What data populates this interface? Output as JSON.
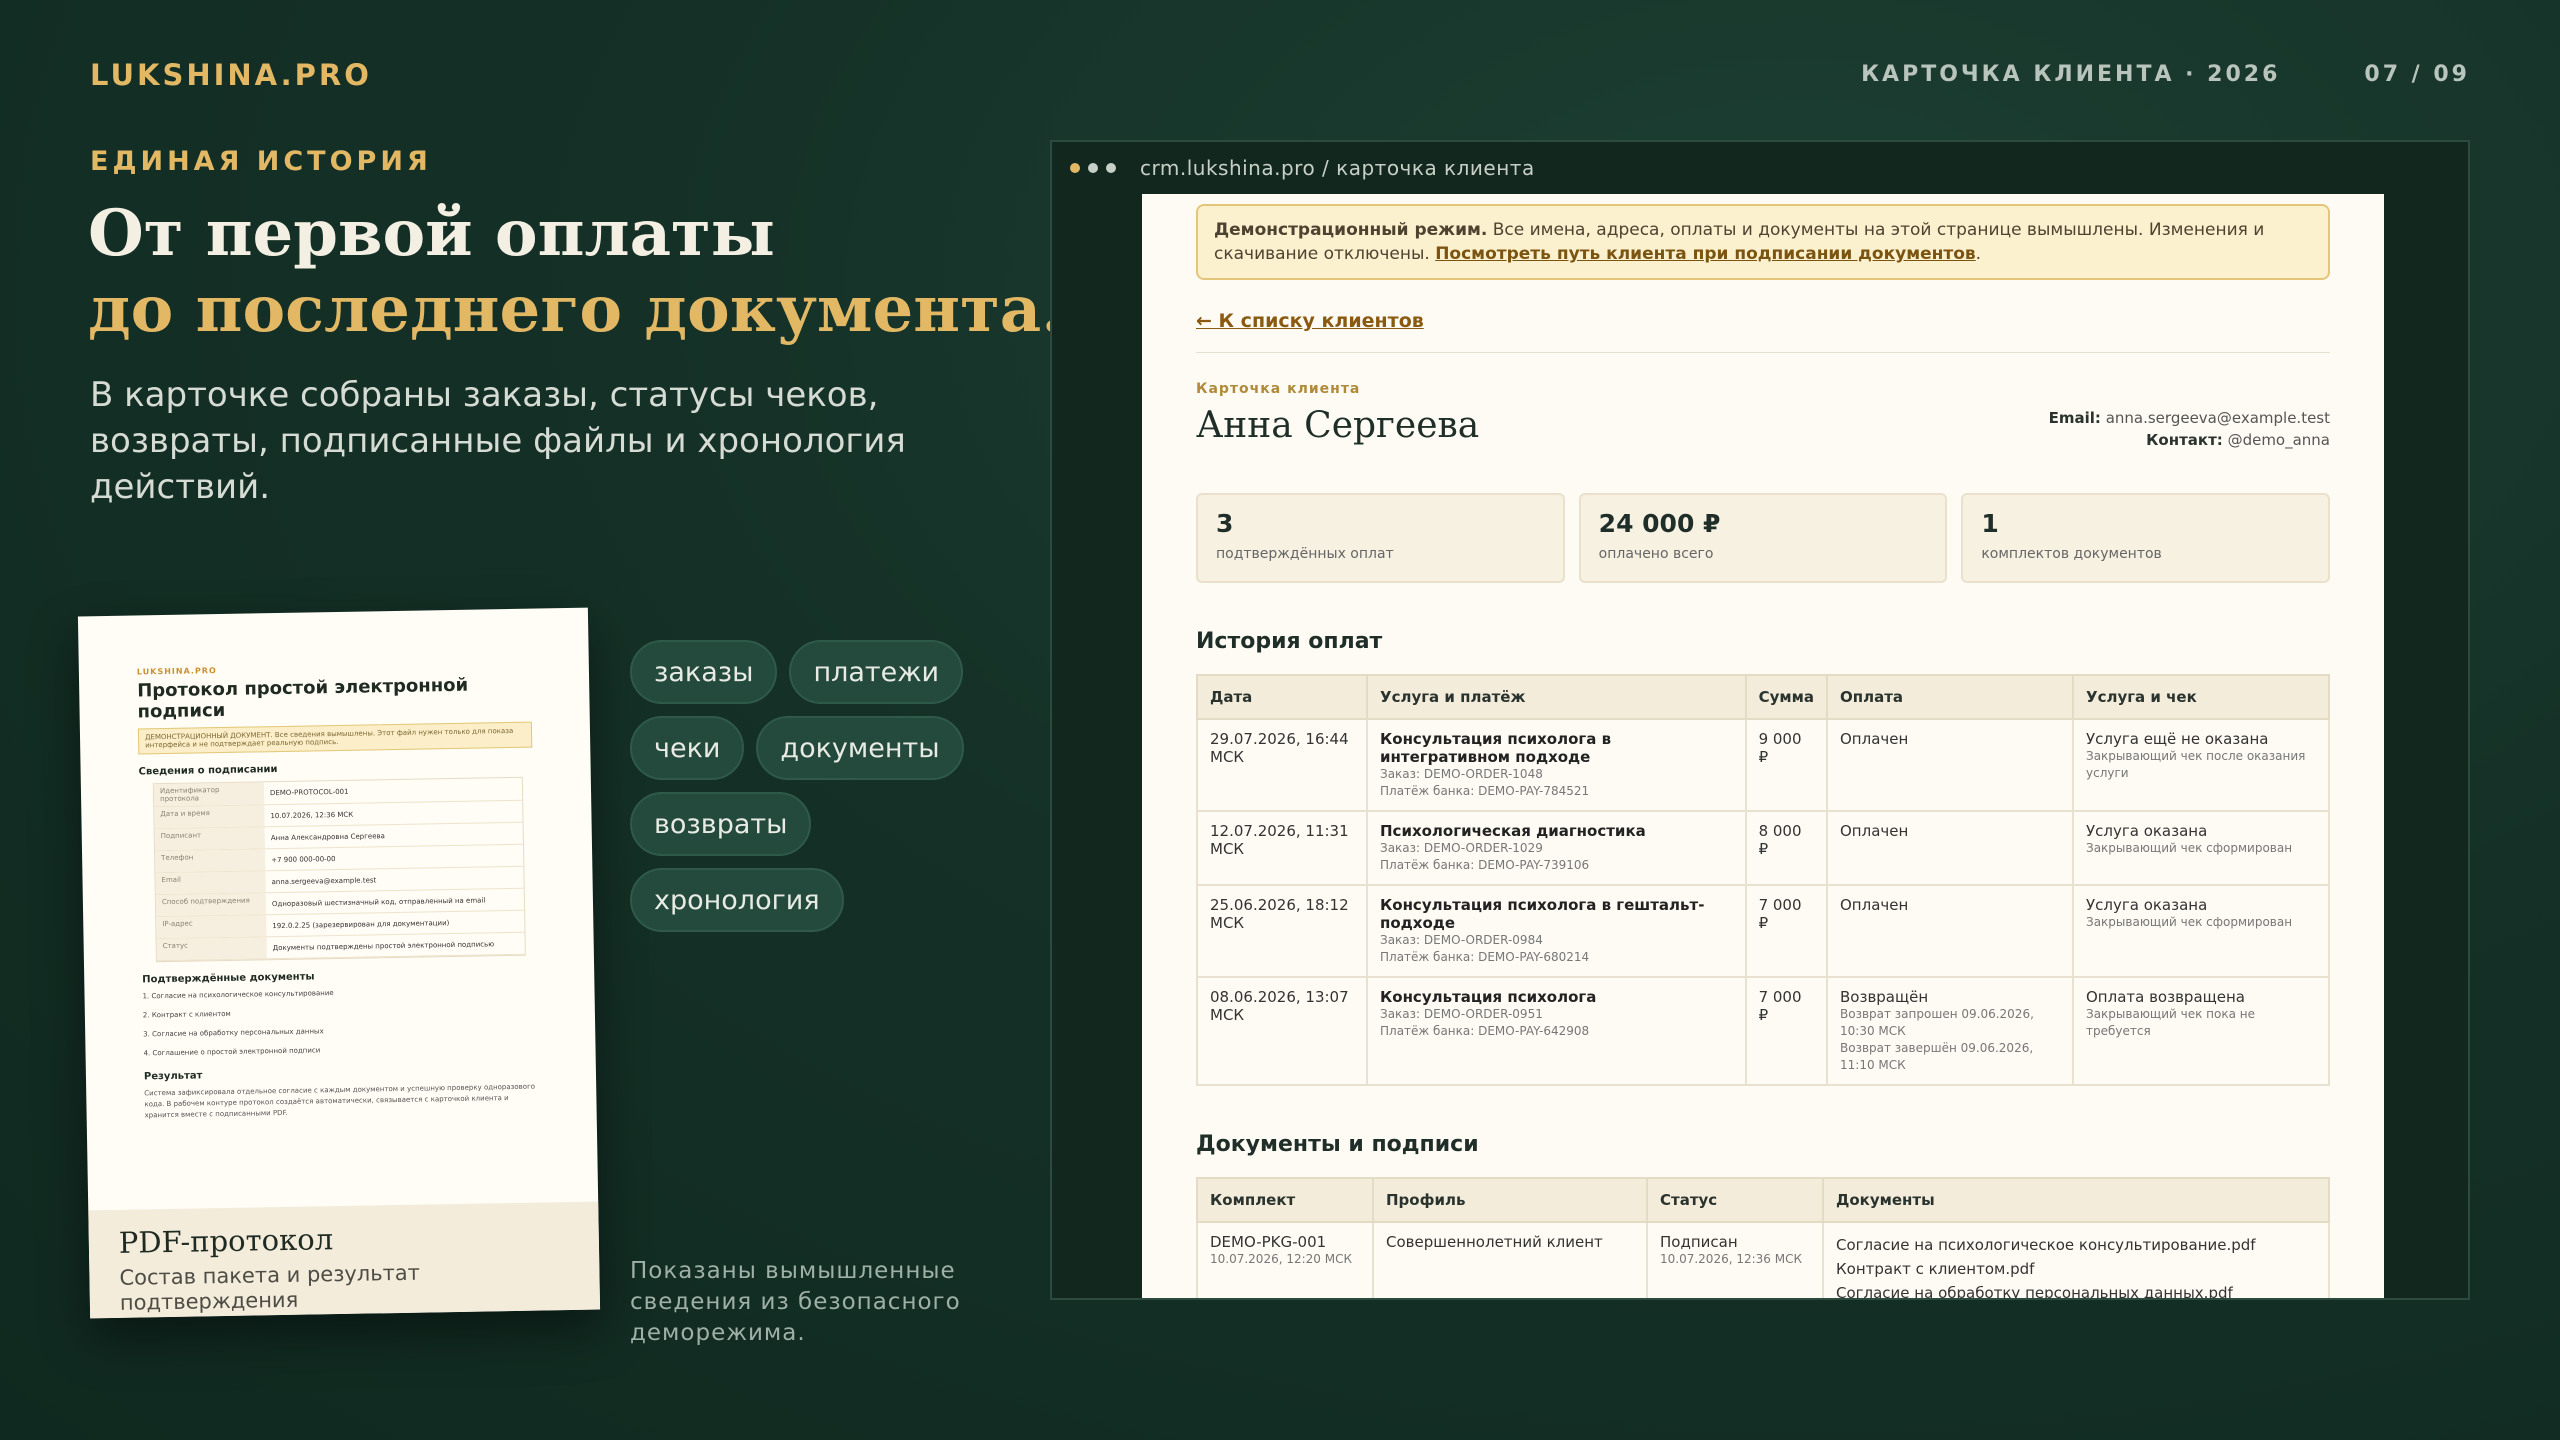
{
  "brand": "LUKSHINA.PRO",
  "slide": {
    "topic": "КАРТОЧКА КЛИЕНТА · 2026",
    "counter": "07 / 09"
  },
  "hero": {
    "eyebrow": "ЕДИНАЯ ИСТОРИЯ",
    "line1": "От первой оплаты",
    "line2": "до последнего документа.",
    "lead": "В карточке собраны заказы, статусы чеков, возвраты, подписанные файлы и хронология действий."
  },
  "pdf": {
    "brand": "LUKSHINA.PRO",
    "title": "Протокол простой электронной подписи",
    "demo": "ДЕМОНСТРАЦИОННЫЙ ДОКУМЕНТ. Все сведения вымышлены. Этот файл нужен только для показа интерфейса и не подтверждает реальную подпись.",
    "section_sign": "Сведения о подписании",
    "rows": [
      {
        "k": "Идентификатор протокола",
        "v": "DEMO-PROTOCOL-001"
      },
      {
        "k": "Дата и время",
        "v": "10.07.2026, 12:36 МСК"
      },
      {
        "k": "Подписант",
        "v": "Анна Александровна Сергеева"
      },
      {
        "k": "Телефон",
        "v": "+7 900 000-00-00"
      },
      {
        "k": "Email",
        "v": "anna.sergeeva@example.test"
      },
      {
        "k": "Способ подтверждения",
        "v": "Одноразовый шестизначный код, отправленный на email"
      },
      {
        "k": "IP-адрес",
        "v": "192.0.2.25 (зарезервирован для документации)"
      },
      {
        "k": "Статус",
        "v": "Документы подтверждены простой электронной подписью"
      }
    ],
    "section_docs": "Подтверждённые документы",
    "docs": [
      "1. Согласие на психологическое консультирование",
      "2. Контракт с клиентом",
      "3. Согласие на обработку персональных данных",
      "4. Соглашение о простой электронной подписи"
    ],
    "section_result": "Результат",
    "result": "Система зафиксировала отдельное согласие с каждым документом и успешную проверку одноразового кода. В рабочем контуре протокол создаётся автоматически, связывается с карточкой клиента и хранится вместе с подписанными PDF.",
    "footer_title": "PDF-протокол",
    "footer_sub": "Состав пакета и результат подтверждения"
  },
  "tags": [
    "заказы",
    "платежи",
    "чеки",
    "документы",
    "возвраты",
    "хронология"
  ],
  "footnote": "Показаны вымышленные сведения из безопасного деморежима.",
  "browser": {
    "url": "crm.lukshina.pro / карточка клиента",
    "dot_colors": [
      "#e2b865",
      "#c8cfc6",
      "#c8cfc6"
    ]
  },
  "crm": {
    "banner_bold": "Демонстрационный режим.",
    "banner_text": " Все имена, адреса, оплаты и документы на этой странице вымышлены. Изменения и скачивание отключены. ",
    "banner_link": "Посмотреть путь клиента при подписании документов",
    "back": "← К списку клиентов",
    "kicker": "Карточка клиента",
    "name": "Анна Сергеева",
    "email_label": "Email:",
    "email": "anna.sergeeva@example.test",
    "contact_label": "Контакт:",
    "contact": "@demo_anna",
    "stats": [
      {
        "n": "3",
        "l": "подтверждённых оплат"
      },
      {
        "n": "24 000 ₽",
        "l": "оплачено всего"
      },
      {
        "n": "1",
        "l": "комплектов документов"
      }
    ],
    "payments_title": "История оплат",
    "payments_headers": [
      "Дата",
      "Услуга и платёж",
      "Сумма",
      "Оплата",
      "Услуга и чек"
    ],
    "payments": [
      {
        "date": "29.07.2026, 16:44 МСК",
        "service": "Консультация психолога в интегративном подходе",
        "order": "Заказ: DEMO-ORDER-1048",
        "bank": "Платёж банка: DEMO-PAY-784521",
        "sum": "9 000 ₽",
        "pay": "Оплачен",
        "pay_sub1": "",
        "pay_sub2": "",
        "check": "Услуга ещё не оказана",
        "check_sub": "Закрывающий чек после оказания услуги"
      },
      {
        "date": "12.07.2026, 11:31 МСК",
        "service": "Психологическая диагностика",
        "order": "Заказ: DEMO-ORDER-1029",
        "bank": "Платёж банка: DEMO-PAY-739106",
        "sum": "8 000 ₽",
        "pay": "Оплачен",
        "pay_sub1": "",
        "pay_sub2": "",
        "check": "Услуга оказана",
        "check_sub": "Закрывающий чек сформирован"
      },
      {
        "date": "25.06.2026, 18:12 МСК",
        "service": "Консультация психолога в гештальт-подходе",
        "order": "Заказ: DEMO-ORDER-0984",
        "bank": "Платёж банка: DEMO-PAY-680214",
        "sum": "7 000 ₽",
        "pay": "Оплачен",
        "pay_sub1": "",
        "pay_sub2": "",
        "check": "Услуга оказана",
        "check_sub": "Закрывающий чек сформирован"
      },
      {
        "date": "08.06.2026, 13:07 МСК",
        "service": "Консультация психолога",
        "order": "Заказ: DEMO-ORDER-0951",
        "bank": "Платёж банка: DEMO-PAY-642908",
        "sum": "7 000 ₽",
        "pay": "Возвращён",
        "pay_sub1": "Возврат запрошен 09.06.2026, 10:30 МСК",
        "pay_sub2": "Возврат завершён 09.06.2026, 11:10 МСК",
        "check": "Оплата возвращена",
        "check_sub": "Закрывающий чек пока не требуется"
      }
    ],
    "docs_title": "Документы и подписи",
    "docs_headers": [
      "Комплект",
      "Профиль",
      "Статус",
      "Документы"
    ],
    "docs_row": {
      "kit": "DEMO-PKG-001",
      "kit_date": "10.07.2026, 12:20 МСК",
      "profile": "Совершеннолетний клиент",
      "status": "Подписан",
      "status_date": "10.07.2026, 12:36 МСК",
      "files": [
        "Согласие на психологическое консультирование.pdf",
        "Контракт с клиентом.pdf",
        "Согласие на обработку персональных данных.pdf"
      ]
    }
  }
}
